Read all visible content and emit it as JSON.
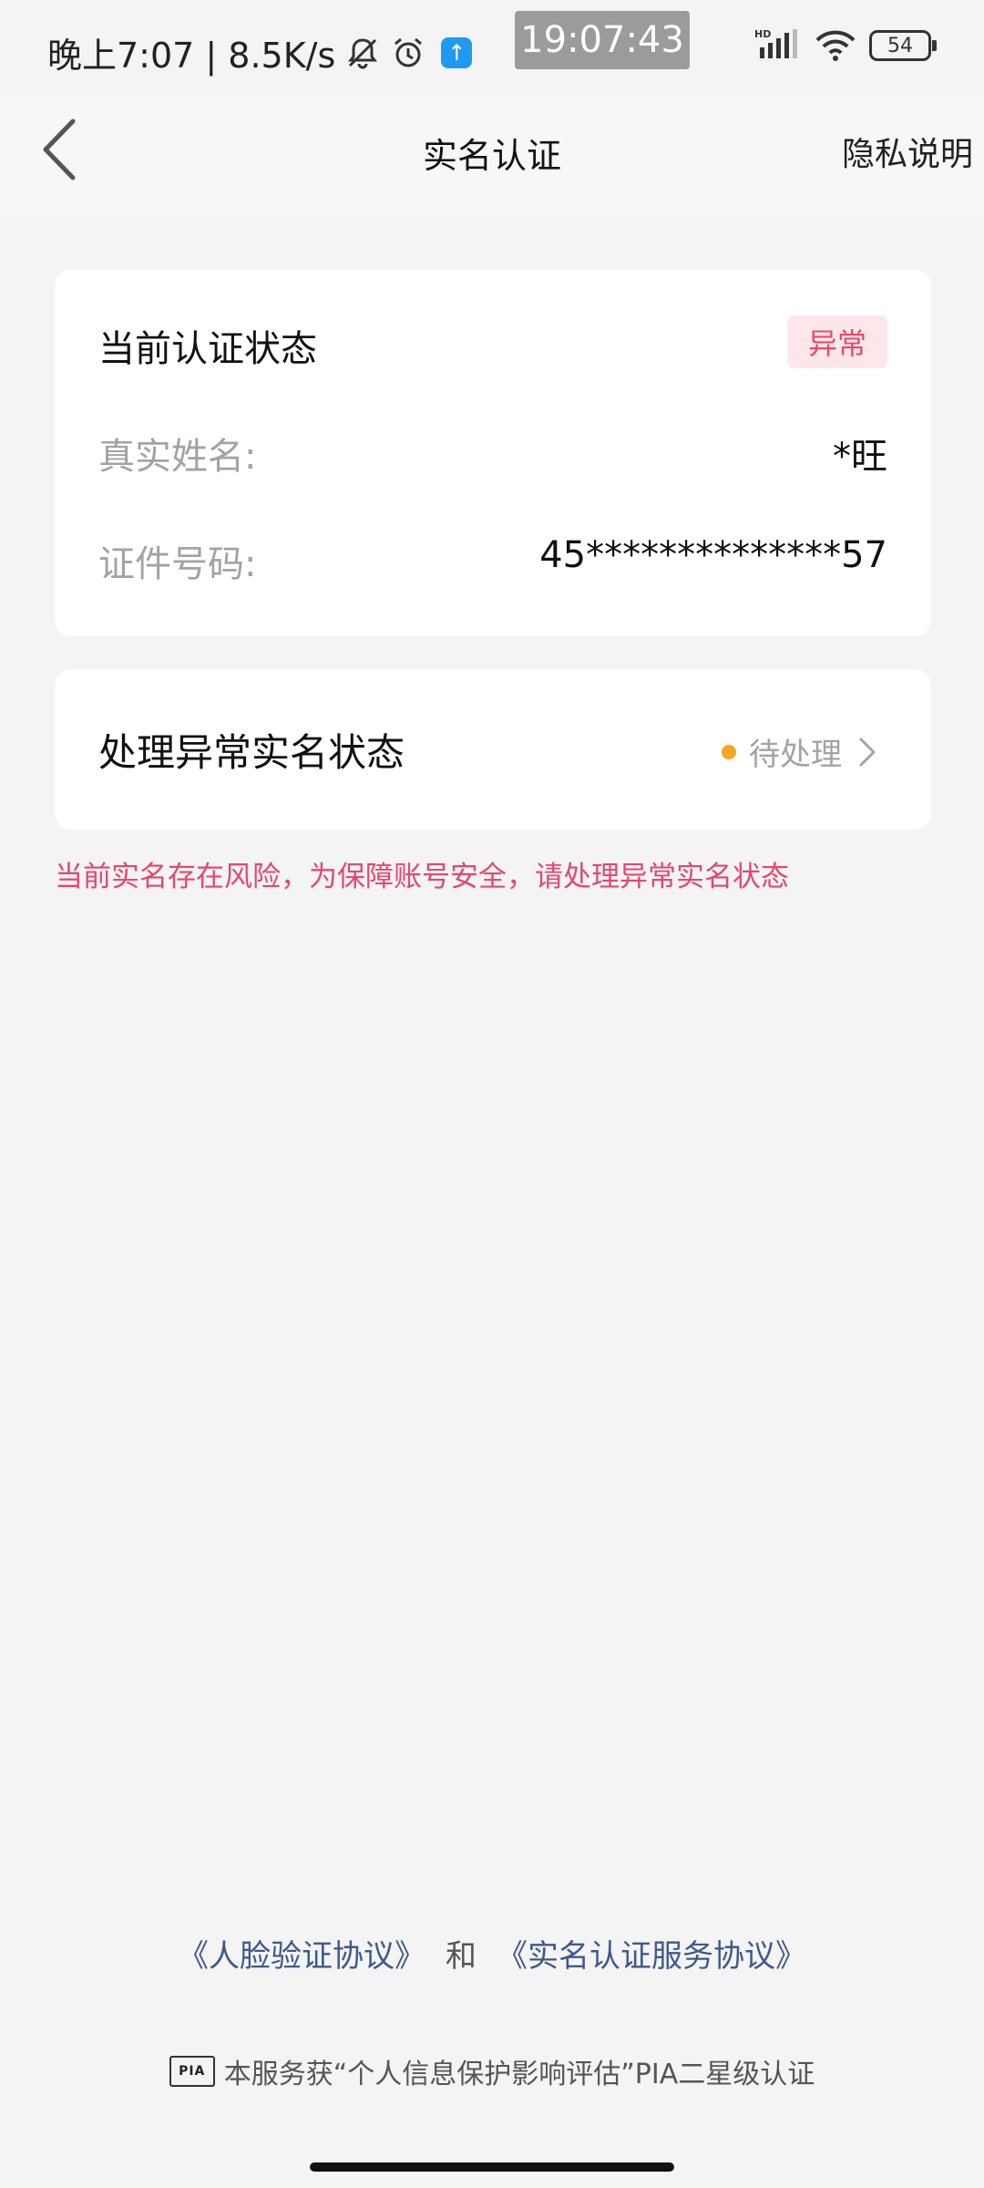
{
  "status_bar": {
    "left_text": "晚上7:07 | 8.5K/s",
    "clock": "19:07:43",
    "battery": "54",
    "network": "HD"
  },
  "header": {
    "title": "实名认证",
    "privacy_label": "隐私说明"
  },
  "auth_card": {
    "title": "当前认证状态",
    "badge": "异常",
    "badge_color": "#e84a6a",
    "rows": [
      {
        "label": "真实姓名:",
        "value": "*旺"
      },
      {
        "label": "证件号码:",
        "value": "45**************57"
      }
    ]
  },
  "process_card": {
    "title": "处理异常实名状态",
    "status": "待处理",
    "status_dot_color": "#f5a623"
  },
  "warning_text": "当前实名存在风险，为保障账号安全，请处理异常实名状态",
  "warning_color": "#e5476e",
  "agreements": {
    "face_link": "《人脸验证协议》",
    "and": "和",
    "service_link": "《实名认证服务协议》"
  },
  "pia": {
    "logo_text": "PIA",
    "text": "本服务获“个人信息保护影响评估”PIA二星级认证"
  }
}
